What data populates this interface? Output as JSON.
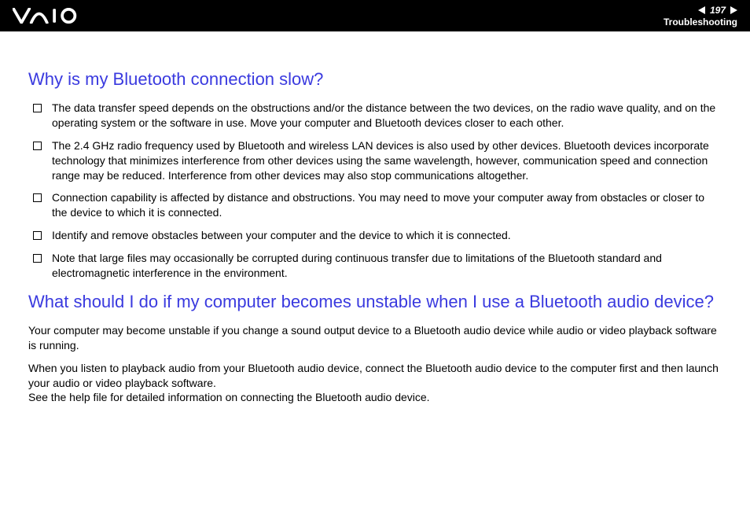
{
  "header": {
    "logo_alt": "VAIO",
    "page_number": "197",
    "section": "Troubleshooting"
  },
  "content": {
    "q1": {
      "title": "Why is my Bluetooth connection slow?",
      "bullets": [
        "The data transfer speed depends on the obstructions and/or the distance between the two devices, on the radio wave quality, and on the operating system or the software in use. Move your computer and Bluetooth devices closer to each other.",
        "The 2.4 GHz radio frequency used by Bluetooth and wireless LAN devices is also used by other devices. Bluetooth devices incorporate technology that minimizes interference from other devices using the same wavelength, however, communication speed and connection range may be reduced. Interference from other devices may also stop communications altogether.",
        "Connection capability is affected by distance and obstructions. You may need to move your computer away from obstacles or closer to the device to which it is connected.",
        "Identify and remove obstacles between your computer and the device to which it is connected.",
        "Note that large files may occasionally be corrupted during continuous transfer due to limitations of the Bluetooth standard and electromagnetic interference in the environment."
      ]
    },
    "q2": {
      "title": "What should I do if my computer becomes unstable when I use a Bluetooth audio device?",
      "paragraphs": [
        "Your computer may become unstable if you change a sound output device to a Bluetooth audio device while audio or video playback software is running.",
        "When you listen to playback audio from your Bluetooth audio device, connect the Bluetooth audio device to the computer first and then launch your audio or video playback software.\nSee the help file for detailed information on connecting the Bluetooth audio device."
      ]
    }
  }
}
